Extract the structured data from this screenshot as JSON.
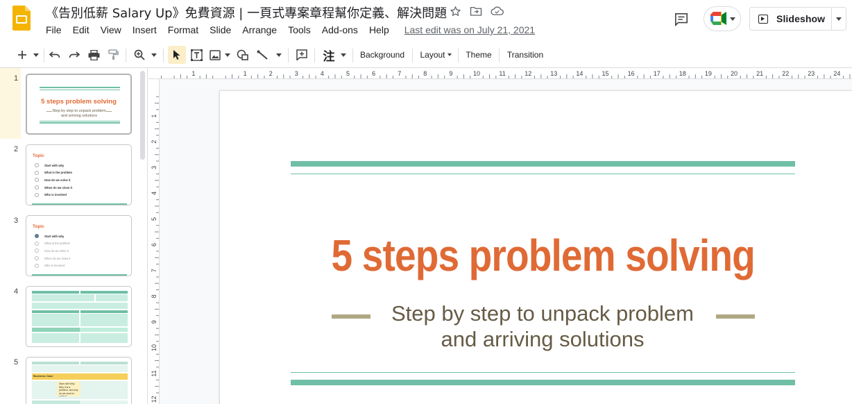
{
  "header": {
    "doc_title": "《告別低薪 Salary Up》免費資源 | 一頁式專案章程幫你定義、解決問題",
    "menu": [
      "File",
      "Edit",
      "View",
      "Insert",
      "Format",
      "Slide",
      "Arrange",
      "Tools",
      "Add-ons",
      "Help"
    ],
    "last_edit": "Last edit was on July 21, 2021",
    "slideshow_label": "Slideshow"
  },
  "toolbar": {
    "input_tools_label": "注",
    "background_label": "Background",
    "layout_label": "Layout",
    "theme_label": "Theme",
    "transition_label": "Transition"
  },
  "ruler": {
    "top_labels": [
      "1",
      "1",
      "2",
      "3",
      "4",
      "5",
      "6",
      "7",
      "8",
      "9",
      "10",
      "11",
      "12",
      "13",
      "14",
      "15",
      "16",
      "17",
      "18",
      "19",
      "20",
      "21",
      "22",
      "23",
      "24"
    ],
    "left_labels": [
      "1",
      "2",
      "3",
      "4",
      "5",
      "6",
      "7",
      "8",
      "9",
      "10",
      "11",
      "12"
    ]
  },
  "filmstrip": {
    "slides": [
      {
        "num": "1",
        "title": "5 steps problem solving",
        "subtitle": "Step by step to unpack problem and arriving solutions"
      },
      {
        "num": "2",
        "heading": "Topic",
        "items": [
          "Start with why",
          "What is the problem",
          "How do we solve it",
          "When do we close it",
          "Who is involved"
        ]
      },
      {
        "num": "3",
        "heading": "Topic",
        "items": [
          "Start with why",
          "What is the problem",
          "How do we solve it",
          "When do we close it",
          "Who is involved"
        ]
      },
      {
        "num": "4"
      },
      {
        "num": "5",
        "callout_title": "Business Case",
        "callout_text": "Start with Why. Why it is a problem, and why do we need to solve it"
      }
    ]
  },
  "slide": {
    "title": "5 steps problem solving",
    "subtitle_line1": "Step by step to unpack problem",
    "subtitle_line2": "and arriving solutions"
  },
  "colors": {
    "title": "#e06a35",
    "subtitle": "#665b45",
    "teal": "#6fbfa6",
    "dash": "#b0a885",
    "accent_yellow": "#f4b400"
  }
}
